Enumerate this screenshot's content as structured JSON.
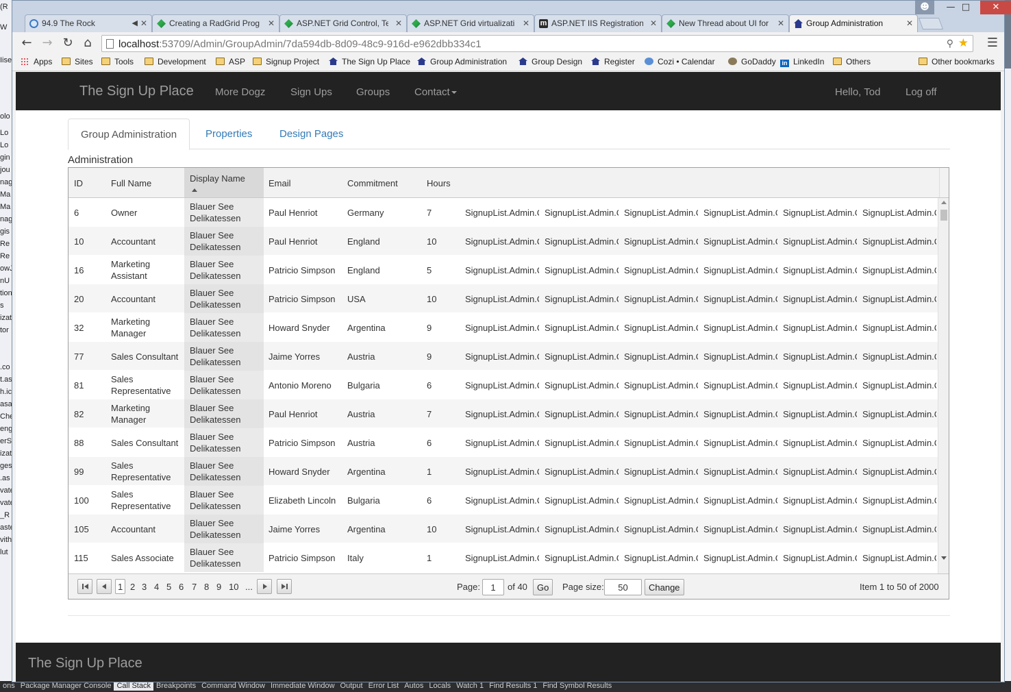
{
  "ide": {
    "left_fragments": [
      "(R",
      "W",
      "Iise",
      "olo",
      "Lo",
      "Lo",
      "gin",
      "jou",
      "nag",
      "Ma",
      "Ma",
      "nag",
      "gis",
      "Re",
      "Re",
      "owJ",
      "nU",
      "tion",
      "s",
      "izat",
      "tor",
      ".co",
      "t.as",
      "h.ic",
      "asa",
      "Che",
      "eng",
      "erS",
      "izat",
      "ges.",
      ".as",
      "vate",
      "vate",
      "_R",
      "aste",
      "vith",
      "lut"
    ],
    "bottom_tabs": [
      "ons",
      "Package Manager Console",
      "Call Stack",
      "Breakpoints",
      "Command Window",
      "Immediate Window",
      "Output",
      "Error List",
      "Autos",
      "Locals",
      "Watch 1",
      "Find Results 1",
      "Find Symbol Results"
    ]
  },
  "browser": {
    "tabs": [
      {
        "title": "94.9 The Rock",
        "icon": "globe"
      },
      {
        "title": "Creating a RadGrid Prog",
        "icon": "telerik"
      },
      {
        "title": "ASP.NET Grid Control, Te",
        "icon": "telerik"
      },
      {
        "title": "ASP.NET Grid virtualizati",
        "icon": "telerik"
      },
      {
        "title": "ASP.NET IIS Registration",
        "icon": "m"
      },
      {
        "title": "New Thread about UI for",
        "icon": "telerik"
      },
      {
        "title": "Group Administration",
        "icon": "house"
      }
    ],
    "url_host": "localhost",
    "url_path": ":53709/Admin/GroupAdmin/7da594db-8d09-48c9-916d-e962dbb334c1",
    "bookmarks": [
      "Apps",
      "Sites",
      "Tools",
      "Development",
      "ASP",
      "Signup Project",
      "The Sign Up Place",
      "Group Administration",
      "Group Design",
      "Register",
      "Cozi • Calendar",
      "GoDaddy",
      "LinkedIn",
      "Others",
      "Other bookmarks"
    ]
  },
  "site": {
    "brand": "The Sign Up Place",
    "nav": [
      "More Dogz",
      "Sign Ups",
      "Groups",
      "Contact"
    ],
    "greeting": "Hello, Tod",
    "logoff": "Log off",
    "footer_brand": "The Sign Up Place"
  },
  "tabs": [
    "Group Administration",
    "Properties",
    "Design Pages"
  ],
  "section_label": "Administration",
  "grid": {
    "columns": [
      "ID",
      "Full Name",
      "Display Name",
      "Email",
      "Commitment",
      "Hours"
    ],
    "sorted_column": "Display Name",
    "extra_cell_text": "SignupList.Admin.C",
    "rows": [
      {
        "id": "6",
        "full_name": "Owner",
        "display_name": "Blauer See Delikatessen",
        "email": "Paul Henriot",
        "commitment": "Germany",
        "hours": "7"
      },
      {
        "id": "10",
        "full_name": "Accountant",
        "display_name": "Blauer See Delikatessen",
        "email": "Paul Henriot",
        "commitment": "England",
        "hours": "10"
      },
      {
        "id": "16",
        "full_name": "Marketing Assistant",
        "display_name": "Blauer See Delikatessen",
        "email": "Patricio Simpson",
        "commitment": "England",
        "hours": "5"
      },
      {
        "id": "20",
        "full_name": "Accountant",
        "display_name": "Blauer See Delikatessen",
        "email": "Patricio Simpson",
        "commitment": "USA",
        "hours": "10"
      },
      {
        "id": "32",
        "full_name": "Marketing Manager",
        "display_name": "Blauer See Delikatessen",
        "email": "Howard Snyder",
        "commitment": "Argentina",
        "hours": "9"
      },
      {
        "id": "77",
        "full_name": "Sales Consultant",
        "display_name": "Blauer See Delikatessen",
        "email": "Jaime Yorres",
        "commitment": "Austria",
        "hours": "9"
      },
      {
        "id": "81",
        "full_name": "Sales Representative",
        "display_name": "Blauer See Delikatessen",
        "email": "Antonio Moreno",
        "commitment": "Bulgaria",
        "hours": "6"
      },
      {
        "id": "82",
        "full_name": "Marketing Manager",
        "display_name": "Blauer See Delikatessen",
        "email": "Paul Henriot",
        "commitment": "Austria",
        "hours": "7"
      },
      {
        "id": "88",
        "full_name": "Sales Consultant",
        "display_name": "Blauer See Delikatessen",
        "email": "Patricio Simpson",
        "commitment": "Austria",
        "hours": "6"
      },
      {
        "id": "99",
        "full_name": "Sales Representative",
        "display_name": "Blauer See Delikatessen",
        "email": "Howard Snyder",
        "commitment": "Argentina",
        "hours": "1"
      },
      {
        "id": "100",
        "full_name": "Sales Representative",
        "display_name": "Blauer See Delikatessen",
        "email": "Elizabeth Lincoln",
        "commitment": "Bulgaria",
        "hours": "6"
      },
      {
        "id": "105",
        "full_name": "Accountant",
        "display_name": "Blauer See Delikatessen",
        "email": "Jaime Yorres",
        "commitment": "Argentina",
        "hours": "10"
      },
      {
        "id": "115",
        "full_name": "Sales Associate",
        "display_name": "Blauer See Delikatessen",
        "email": "Patricio Simpson",
        "commitment": "Italy",
        "hours": "1"
      }
    ]
  },
  "pager": {
    "pages": [
      "1",
      "2",
      "3",
      "4",
      "5",
      "6",
      "7",
      "8",
      "9",
      "10",
      "..."
    ],
    "current_page": "1",
    "page_label": "Page:",
    "of_label": "of 40",
    "go_label": "Go",
    "page_size_label": "Page size:",
    "page_size": "50",
    "change_label": "Change",
    "summary": "Item 1 to 50 of 2000"
  }
}
